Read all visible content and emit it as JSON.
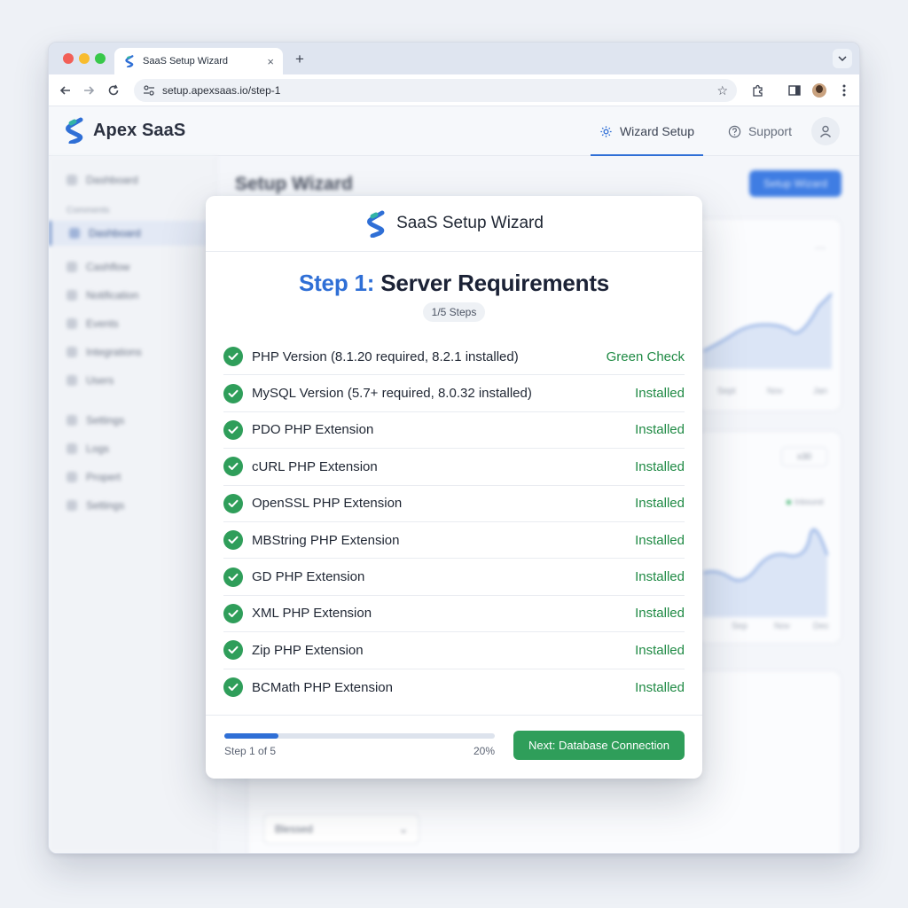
{
  "browser": {
    "tab_title": "SaaS Setup Wizard",
    "url": "setup.apexsaas.io/step-1"
  },
  "app": {
    "brand": "Apex SaaS",
    "nav": [
      {
        "label": "Wizard Setup",
        "icon": "gear-icon",
        "active": true
      },
      {
        "label": "Support",
        "icon": "help-circle-icon",
        "active": false
      }
    ]
  },
  "background": {
    "page_title": "Setup Wizard",
    "action_button": "Setup Wizard",
    "sidebar": [
      {
        "label": "Dashboard",
        "type": "item"
      },
      {
        "label": "Comments",
        "type": "section"
      },
      {
        "label": "Dashboard",
        "type": "item",
        "active": true
      },
      {
        "label": "Cashflow",
        "type": "item"
      },
      {
        "label": "Notification",
        "type": "item"
      },
      {
        "label": "Events",
        "type": "item"
      },
      {
        "label": "Integrations",
        "type": "item"
      },
      {
        "label": "Users",
        "type": "item"
      },
      {
        "label": "Settings",
        "type": "item"
      },
      {
        "label": "Logs",
        "type": "item"
      },
      {
        "label": "Propert",
        "type": "item"
      },
      {
        "label": "Settings",
        "type": "item"
      }
    ],
    "chart1_labels": [
      "Sept",
      "Nov",
      "Jan"
    ],
    "chart2_labels": [
      "Sep",
      "Nov",
      "Dec"
    ],
    "chart2_filter": "x30",
    "chart2_legend": "Inbound",
    "select_value": "Blessed"
  },
  "wizard": {
    "header_title": "SaaS Setup Wizard",
    "step_prefix": "Step 1:",
    "step_title": "Server Requirements",
    "step_pill": "1/5 Steps",
    "requirements": [
      {
        "label": "PHP Version (8.1.20 required, 8.2.1 installed)",
        "status": "Green Check"
      },
      {
        "label": "MySQL Version (5.7+ required, 8.0.32 installed)",
        "status": "Installed"
      },
      {
        "label": "PDO PHP Extension",
        "status": "Installed"
      },
      {
        "label": "cURL PHP Extension",
        "status": "Installed"
      },
      {
        "label": "OpenSSL PHP Extension",
        "status": "Installed"
      },
      {
        "label": "MBString PHP Extension",
        "status": "Installed"
      },
      {
        "label": "GD PHP Extension",
        "status": "Installed"
      },
      {
        "label": "XML PHP Extension",
        "status": "Installed"
      },
      {
        "label": "Zip PHP Extension",
        "status": "Installed"
      },
      {
        "label": "BCMath PHP Extension",
        "status": "Installed"
      }
    ],
    "progress_text": "Step 1 of 5",
    "progress_percent_label": "20%",
    "progress_value": 0.2,
    "next_button": "Next: Database Connection"
  },
  "colors": {
    "accent_blue": "#2f6fd6",
    "success_green": "#2f9e5a",
    "status_green": "#1f8a44"
  }
}
